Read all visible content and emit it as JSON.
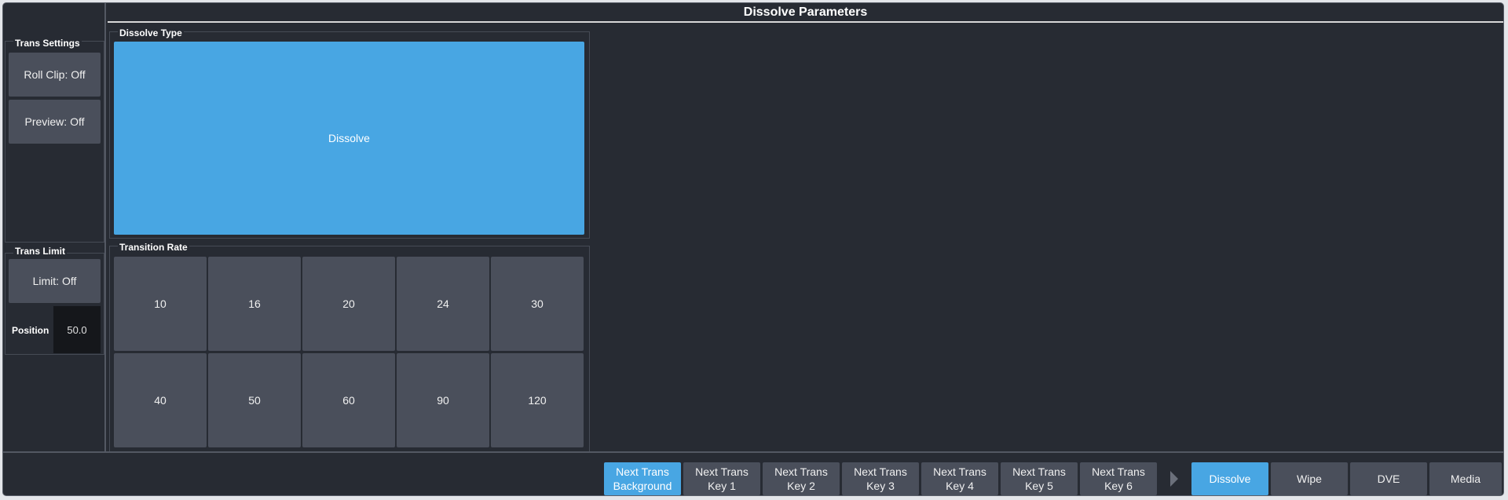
{
  "header": {
    "title": "Dissolve Parameters"
  },
  "trans_settings": {
    "label": "Trans Settings",
    "roll_clip": "Roll Clip: Off",
    "preview": "Preview: Off"
  },
  "trans_limit": {
    "label": "Trans Limit",
    "limit": "Limit: Off",
    "position_label": "Position",
    "position_value": "50.0"
  },
  "dissolve_type": {
    "label": "Dissolve Type",
    "option": "Dissolve"
  },
  "transition_rate": {
    "label": "Transition Rate",
    "rates": [
      "10",
      "16",
      "20",
      "24",
      "30",
      "40",
      "50",
      "60",
      "90",
      "120"
    ]
  },
  "bottom_bar": {
    "next_trans": [
      {
        "line1": "Next Trans",
        "line2": "Background"
      },
      {
        "line1": "Next Trans",
        "line2": "Key 1"
      },
      {
        "line1": "Next Trans",
        "line2": "Key 2"
      },
      {
        "line1": "Next Trans",
        "line2": "Key 3"
      },
      {
        "line1": "Next Trans",
        "line2": "Key 4"
      },
      {
        "line1": "Next Trans",
        "line2": "Key 5"
      },
      {
        "line1": "Next Trans",
        "line2": "Key 6"
      }
    ],
    "types": [
      "Dissolve",
      "Wipe",
      "DVE",
      "Media"
    ]
  },
  "colors": {
    "active": "#48a6e3",
    "button": "#4a4f5b",
    "background": "#272b33"
  },
  "icons": {
    "scroll_arrow": "triangle-right-icon"
  }
}
